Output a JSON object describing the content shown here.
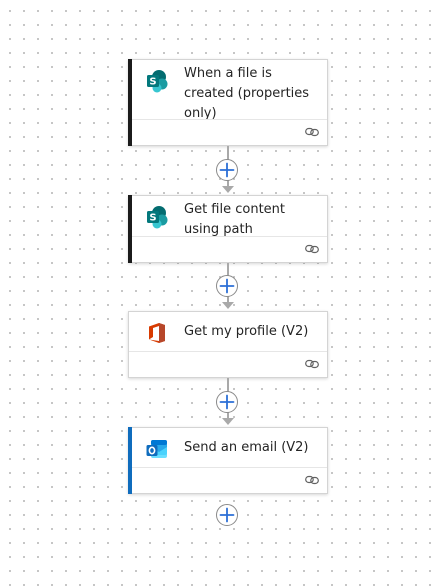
{
  "flow": {
    "steps": [
      {
        "title": "When a file is created (properties only)",
        "icon": "sharepoint-icon",
        "accent_color": "#1b1b1b"
      },
      {
        "title": "Get file content using path",
        "icon": "sharepoint-icon",
        "accent_color": "#1b1b1b"
      },
      {
        "title": "Get my profile (V2)",
        "icon": "office365-icon",
        "accent_color": "#ffffff"
      },
      {
        "title": "Send an email (V2)",
        "icon": "outlook-icon",
        "accent_color": "#0f6cbd"
      }
    ],
    "footer_icon": "link-icon",
    "add_button_icon": "plus-icon"
  },
  "colors": {
    "plus": "#2b6fd6",
    "connector": "#a9a9a9",
    "sharepoint_teal": "#038387",
    "office_red": "#d83b01",
    "outlook_blue": "#0f6cbd"
  }
}
